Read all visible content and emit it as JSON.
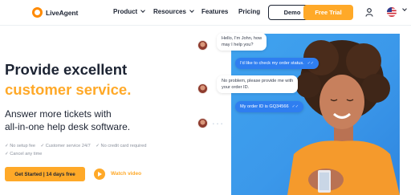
{
  "nav": {
    "logo_text": "LiveAgent",
    "links": [
      {
        "label": "Product",
        "has_dropdown": true
      },
      {
        "label": "Resources",
        "has_dropdown": true
      },
      {
        "label": "Features",
        "has_dropdown": false
      },
      {
        "label": "Pricing",
        "has_dropdown": false
      }
    ],
    "demo_label": "Demo",
    "trial_label": "Free Trial",
    "user_icon": "user-icon",
    "flag_icon": "us-flag-icon"
  },
  "hero": {
    "title": "Provide excellent",
    "title_accent": "customer service.",
    "subtitle_line1": "Answer more tickets with",
    "subtitle_line2": "all-in-one help desk software.",
    "checks": [
      "✓ No setup fee",
      "✓ Customer service 24/7",
      "✓ No credit card required",
      "✓ Cancel any time"
    ],
    "cta_label": "Get Started | 14 days free",
    "watch_label": "Watch video"
  },
  "chat": {
    "msg1": "Hello, I'm John, how",
    "msg1b": "may I help you?",
    "msg2": "I'd like to check my order status.",
    "msg3": "No problem, please provide me with",
    "msg3b": "your order ID.",
    "msg4": "My order ID is GQ34566",
    "typing": "• • •"
  },
  "colors": {
    "accent": "#ffa928",
    "brand_dark": "#1d2433",
    "chat_blue": "#2f7ef0",
    "photo_bg": "#3b98ea"
  }
}
